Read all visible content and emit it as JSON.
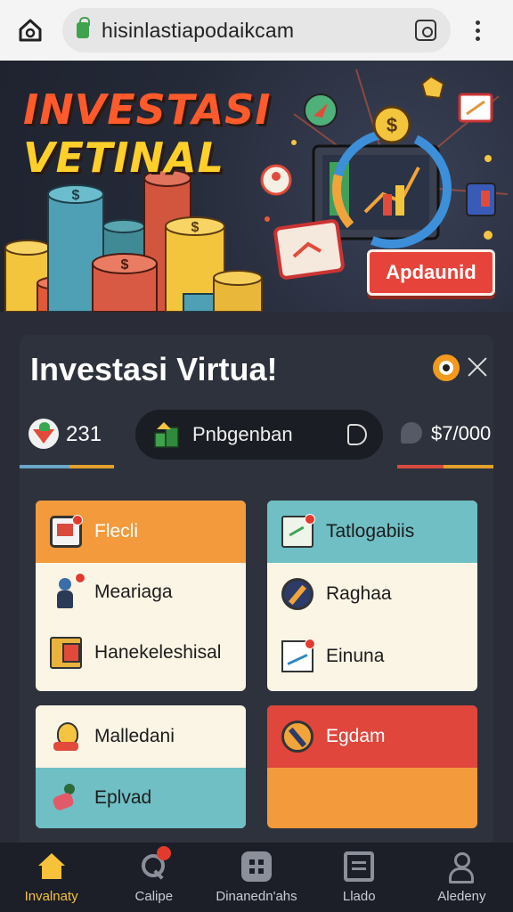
{
  "browser": {
    "url": "hisinlastiapodaikcam"
  },
  "hero": {
    "title_line1": "INVESTASI",
    "title_line2": "VETINAL",
    "cta_label": "Apdaunid"
  },
  "panel": {
    "title": "Investasi Virtua!",
    "stats": {
      "score": "231",
      "mid_label": "Pnbgenban",
      "money": "$7/000"
    },
    "cards": [
      {
        "rows": [
          {
            "label": "Flecli",
            "icon": "phone-icon"
          },
          {
            "label": "Meariaga",
            "icon": "person-icon"
          },
          {
            "label": "Hanekeleshisal",
            "icon": "ledger-icon"
          }
        ]
      },
      {
        "rows": [
          {
            "label": "Tatlogabiis",
            "icon": "document-icon"
          },
          {
            "label": "Raghaa",
            "icon": "tool-icon"
          },
          {
            "label": "Einuna",
            "icon": "chart-icon"
          }
        ]
      },
      {
        "rows": [
          {
            "label": "Malledani",
            "icon": "lightbulb-icon"
          },
          {
            "label": "Eplvad",
            "icon": "runner-icon"
          }
        ]
      },
      {
        "rows": [
          {
            "label": "Egdam",
            "icon": "hammer-icon"
          }
        ]
      }
    ]
  },
  "nav": {
    "items": [
      {
        "label": "Invalnaty",
        "icon": "home-icon",
        "active": true
      },
      {
        "label": "Calipe",
        "icon": "search-icon"
      },
      {
        "label": "Dinanedn'ahs",
        "icon": "grid-icon"
      },
      {
        "label": "Llado",
        "icon": "list-icon"
      },
      {
        "label": "Aledeny",
        "icon": "user-icon"
      }
    ]
  },
  "colors": {
    "accent_orange": "#f39a3c",
    "accent_teal": "#6fbfc5",
    "accent_red": "#e24a3a",
    "nav_active": "#f5c23a",
    "panel_bg": "#2e323d"
  }
}
